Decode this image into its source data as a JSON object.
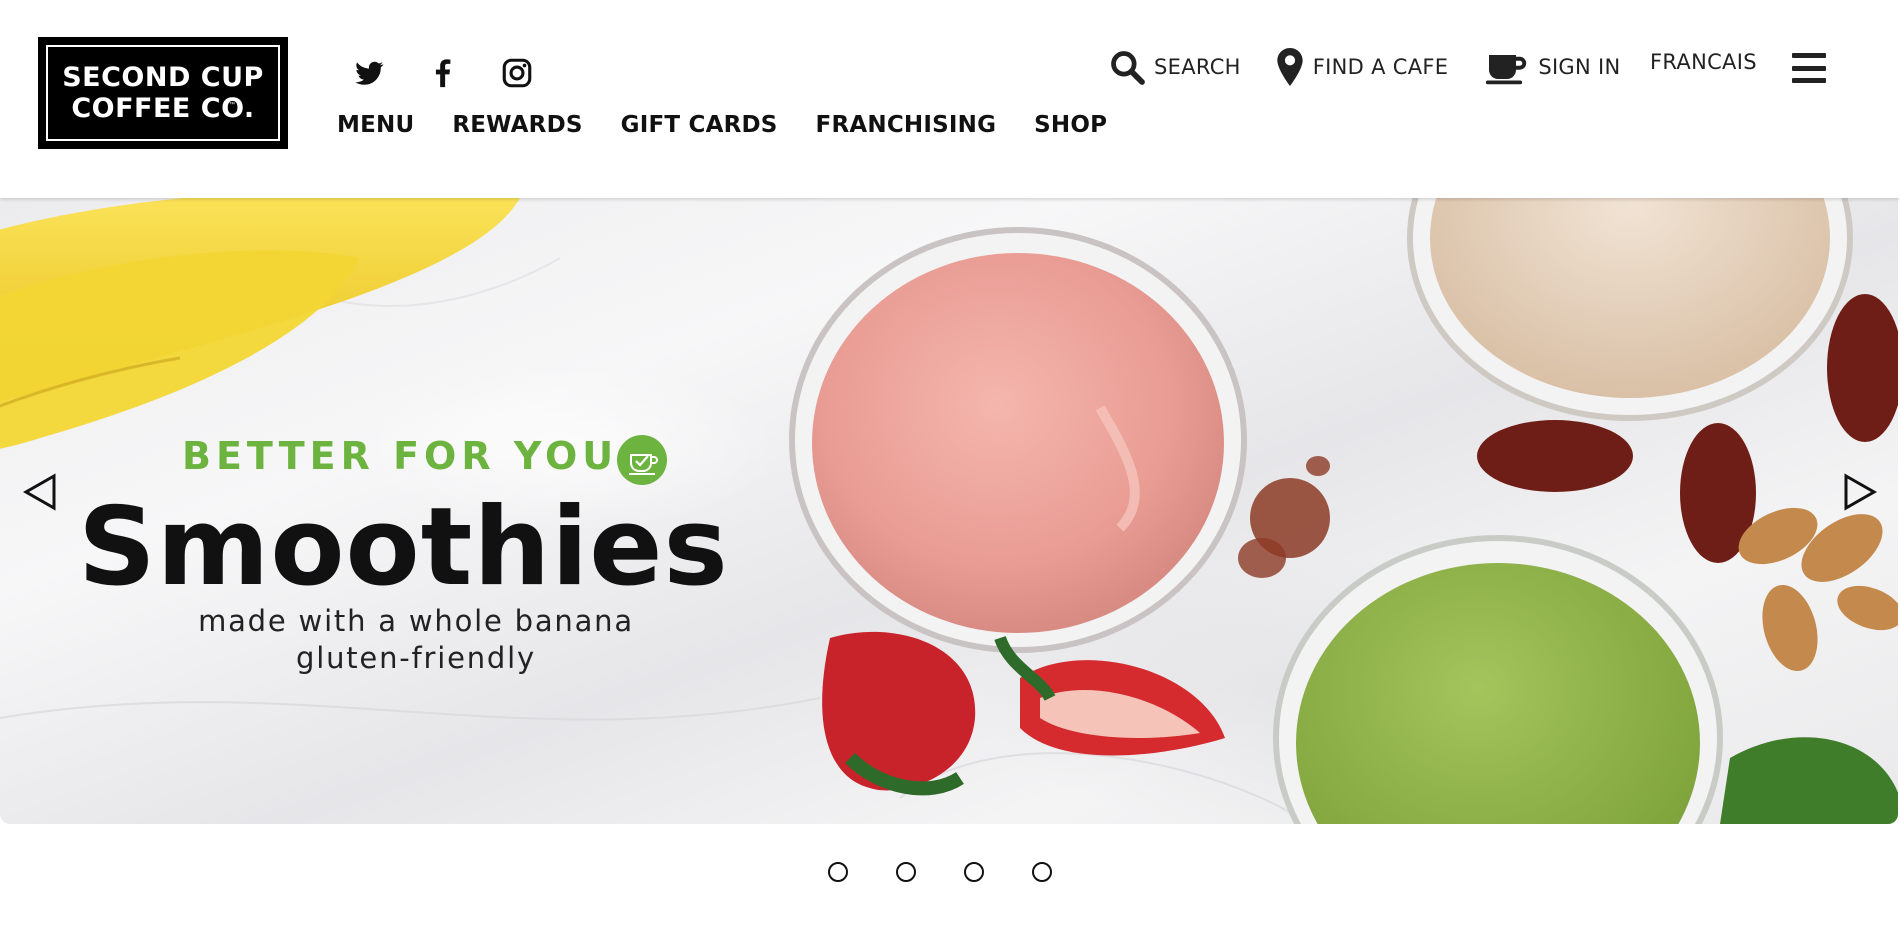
{
  "brand": {
    "logo_line1": "SECOND CUP",
    "logo_line2": "COFFEE CO.",
    "logo_tm": "™"
  },
  "social": [
    {
      "icon": "twitter-icon"
    },
    {
      "icon": "facebook-icon"
    },
    {
      "icon": "instagram-icon"
    }
  ],
  "nav": {
    "items": [
      "MENU",
      "REWARDS",
      "GIFT CARDS",
      "FRANCHISING",
      "SHOP"
    ]
  },
  "utility": {
    "search_label": "SEARCH",
    "find_label": "FIND A CAFE",
    "signin_label": "SIGN IN",
    "language_label": "FRANCAIS"
  },
  "hero": {
    "eyebrow": "BETTER FOR YOU",
    "headline": "Smoothies",
    "sub_line1": "made with a whole banana",
    "sub_line2": "gluten-friendly",
    "accent_color": "#6cb33f"
  },
  "carousel": {
    "slide_count": 4
  }
}
